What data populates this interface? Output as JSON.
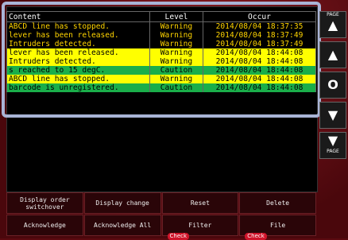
{
  "table": {
    "headers": {
      "content": "Content",
      "level": "Level",
      "occur": "Occur"
    },
    "rows": [
      {
        "content": "ABCD line has stopped.",
        "level": "Warning",
        "occur": "2014/08/04 18:37:35",
        "style": "warn-dark"
      },
      {
        "content": " lever has been released.",
        "level": "Warning",
        "occur": "2014/08/04 18:37:49",
        "style": "warn-dark"
      },
      {
        "content": "Intruders detected.",
        "level": "Warning",
        "occur": "2014/08/04 18:37:49",
        "style": "warn-dark"
      },
      {
        "content": " lever has been released.",
        "level": "Warning",
        "occur": "2014/08/04 18:44:08",
        "style": "warn-yellow"
      },
      {
        "content": "Intruders detected.",
        "level": "Warning",
        "occur": "2014/08/04 18:44:08",
        "style": "warn-yellow"
      },
      {
        "content": "s reached to    15 degC.",
        "level": "Caution",
        "occur": "2014/08/04 18:44:08",
        "style": "caution"
      },
      {
        "content": "ABCD line has stopped.",
        "level": "Warning",
        "occur": "2014/08/04 18:44:08",
        "style": "warn-yellow"
      },
      {
        "content": "barcode is unregistered.",
        "level": "Caution",
        "occur": "2014/08/04 18:44:08",
        "style": "caution"
      }
    ]
  },
  "side": {
    "page_up_label": "PAGE",
    "page_down_label": "PAGE",
    "up_glyph": "▲",
    "down_glyph": "▼",
    "ok_glyph": "O"
  },
  "buttons": {
    "display_order": "Display order switchover",
    "display_change": "Display change",
    "reset": "Reset",
    "delete": "Delete",
    "acknowledge": "Acknowledge",
    "acknowledge_all": "Acknowledge All",
    "filter": "Filter",
    "file": "File",
    "check": "Check"
  }
}
